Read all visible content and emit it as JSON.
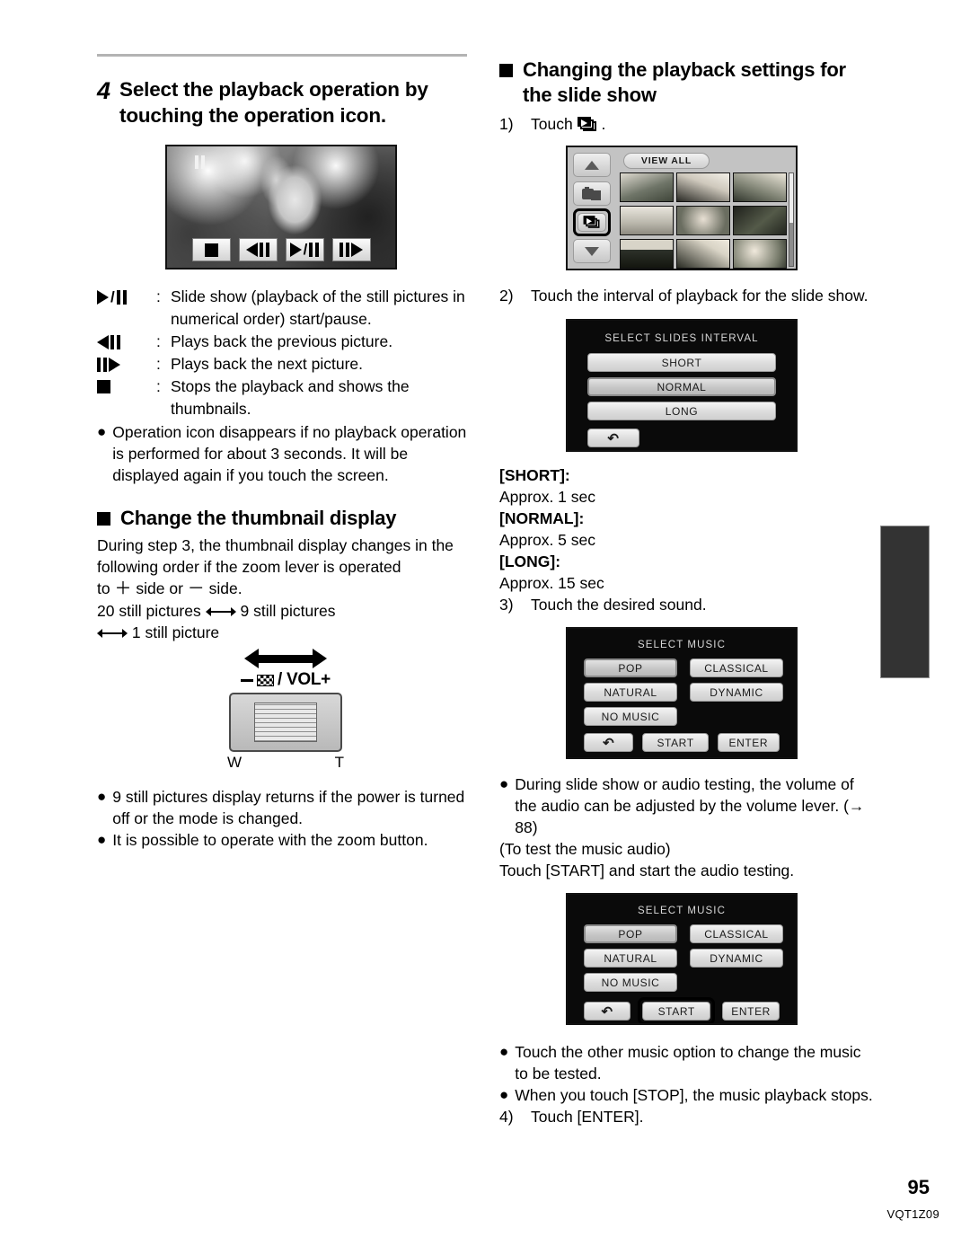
{
  "page": {
    "number": "95",
    "doc_code": "VQT1Z09"
  },
  "left": {
    "step": {
      "number": "4",
      "title": "Select the playback operation by touching the operation icon."
    },
    "playback_screenshot": {
      "name": "still-picture-playback-screen",
      "pause_indicator": "pause",
      "controls": [
        "stop",
        "previous",
        "play-pause",
        "next"
      ]
    },
    "icon_legend": [
      {
        "icon": "play-pause",
        "colon": ":",
        "text": "Slide show (playback of the still pictures in numerical order) start/pause."
      },
      {
        "icon": "previous",
        "colon": ":",
        "text": "Plays back the previous picture."
      },
      {
        "icon": "next",
        "colon": ":",
        "text": "Plays back the next picture."
      },
      {
        "icon": "stop",
        "colon": ":",
        "text": "Stops the playback and shows the thumbnails."
      }
    ],
    "notes_after_legend": [
      "Operation icon disappears if no playback operation is performed for about 3 seconds. It will be displayed again if you touch the screen."
    ],
    "thumbnail_section": {
      "title": "Change the thumbnail display",
      "paragraph_1": "During step 3, the thumbnail display changes in the following order if the zoom lever is operated",
      "paragraph_2_pre": "to",
      "paragraph_2_mid": "side or",
      "paragraph_2_post": "side.",
      "order_line_1_a": "20 still pictures",
      "order_line_1_b": "9 still pictures",
      "order_line_2": "1 still picture"
    },
    "zoom_lever": {
      "label_minus": "−",
      "label_rest": "/ VOL+",
      "left_mark": "W",
      "right_mark": "T"
    },
    "notes_bottom": [
      "9 still pictures display returns if the power is turned off or the mode is changed.",
      "It is possible to operate with the zoom button."
    ]
  },
  "right": {
    "section_title": "Changing the playback settings for the slide show",
    "step1": {
      "number": "1)",
      "text_before_icon": "Touch",
      "icon": "slide-show-icon",
      "text_after_icon": "."
    },
    "view_all_screen": {
      "name": "thumbnail-browser-screen",
      "view_all_label": "VIEW ALL",
      "side_icons": [
        "scroll-up",
        "photo-mode",
        "slide-show",
        "scroll-down"
      ],
      "highlighted_icon": "slide-show"
    },
    "step2": {
      "number": "2)",
      "text": "Touch the interval of playback for the slide show."
    },
    "interval_screen": {
      "name": "select-slides-interval-screen",
      "title": "SELECT SLIDES INTERVAL",
      "options": [
        "SHORT",
        "NORMAL",
        "LONG"
      ],
      "selected": "NORMAL",
      "back_button": "back-arrow"
    },
    "interval_definitions": [
      {
        "term": "[SHORT]:",
        "value": "Approx. 1 sec"
      },
      {
        "term": "[NORMAL]:",
        "value": "Approx. 5 sec"
      },
      {
        "term": "[LONG]:",
        "value": "Approx. 15 sec"
      }
    ],
    "step3": {
      "number": "3)",
      "text": "Touch the desired sound."
    },
    "music_screen_1": {
      "name": "select-music-screen",
      "title": "SELECT MUSIC",
      "options": [
        "POP",
        "CLASSICAL",
        "NATURAL",
        "DYNAMIC",
        "NO MUSIC"
      ],
      "selected": "POP",
      "actions": [
        "back-arrow",
        "START",
        "ENTER"
      ],
      "highlighted_action": null
    },
    "notes_mid": [
      "During slide show or audio testing, the volume of the audio can be adjusted by the volume lever. (→ 88)"
    ],
    "test_audio_note_1": "(To test the music audio)",
    "test_audio_note_2": "Touch [START] and start the audio testing.",
    "music_screen_2": {
      "name": "select-music-screen-start-highlighted",
      "title": "SELECT MUSIC",
      "options": [
        "POP",
        "CLASSICAL",
        "NATURAL",
        "DYNAMIC",
        "NO MUSIC"
      ],
      "selected": "POP",
      "actions": [
        "back-arrow",
        "START",
        "ENTER"
      ],
      "highlighted_action": "START"
    },
    "notes_bottom": [
      "Touch the other music option to change the music to be tested.",
      "When you touch [STOP], the music playback stops."
    ],
    "step4": {
      "number": "4)",
      "text": "Touch [ENTER]."
    }
  },
  "reference_page": "88"
}
